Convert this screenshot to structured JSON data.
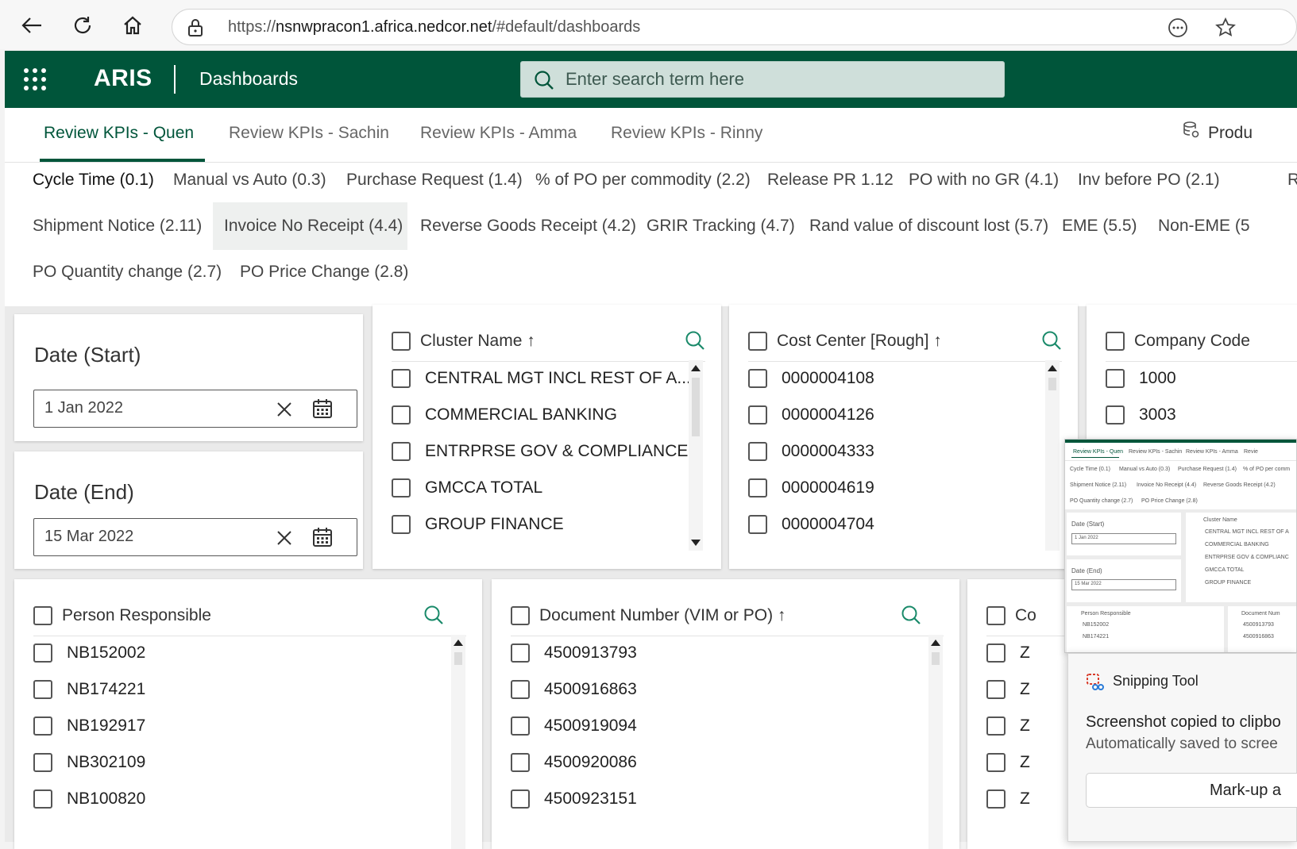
{
  "browser": {
    "url_prefix": "https://",
    "url_host": "nsnwpracon1.africa.nedcor.net",
    "url_path": "/#default/dashboards"
  },
  "header": {
    "brand": "ARIS",
    "app_name": "Dashboards",
    "search_placeholder": "Enter search term here",
    "accent_color": "#00553a"
  },
  "tabs": [
    {
      "label": "Review KPIs - Quen",
      "active": true
    },
    {
      "label": "Review KPIs - Sachin",
      "active": false
    },
    {
      "label": "Review KPIs - Amma",
      "active": false
    },
    {
      "label": "Review KPIs - Rinny",
      "active": false
    },
    {
      "label": "Produ",
      "active": false
    }
  ],
  "subtabs": [
    "Cycle Time (0.1)",
    "Manual vs Auto (0.3)",
    "Purchase Request (1.4)",
    "% of PO per commodity (2.2)",
    "Release PR 1.12",
    "PO with no GR (4.1)",
    "Inv before PO (2.1)",
    "R",
    "Shipment Notice (2.11)",
    "Invoice No Receipt (4.4)",
    "Reverse Goods Receipt (4.2)",
    "GRIR Tracking (4.7)",
    "Rand value of discount lost (5.7)",
    "EME (5.5)",
    "Non-EME (5",
    "PO Quantity change (2.7)",
    "PO Price Change (2.8)"
  ],
  "date_start": {
    "title": "Date (Start)",
    "value": "1 Jan 2022"
  },
  "date_end": {
    "title": "Date (End)",
    "value": "15 Mar 2022"
  },
  "cluster": {
    "title": "Cluster Name",
    "items": [
      "CENTRAL MGT INCL REST OF A...",
      "COMMERCIAL BANKING",
      "ENTRPRSE GOV & COMPLIANCE",
      "GMCCA TOTAL",
      "GROUP FINANCE"
    ]
  },
  "cost_center": {
    "title": "Cost Center [Rough]",
    "items": [
      "0000004108",
      "0000004126",
      "0000004333",
      "0000004619",
      "0000004704"
    ]
  },
  "company_code": {
    "title": "Company Code",
    "items": [
      "1000",
      "3003"
    ]
  },
  "person": {
    "title": "Person Responsible",
    "items": [
      "NB152002",
      "NB174221",
      "NB192917",
      "NB302109",
      "NB100820"
    ]
  },
  "document": {
    "title": "Document Number (VIM or PO)",
    "items": [
      "4500913793",
      "4500916863",
      "4500919094",
      "4500920086",
      "4500923151"
    ]
  },
  "partial_card": {
    "title": "Co",
    "items": [
      "Z",
      "Z",
      "Z",
      "Z",
      "Z"
    ]
  },
  "thumbnail": {
    "tabs": [
      "Review KPIs - Quen",
      "Review KPIs - Sachin",
      "Review KPIs - Amma",
      "Revie"
    ],
    "row1": [
      "Cycle Time (0.1)",
      "Manual vs Auto (0.3)",
      "Purchase Request (1.4)",
      "% of PO per comm"
    ],
    "row2": [
      "Shipment Notice (2.11)",
      "Invoice No Receipt (4.4)",
      "Reverse Goods Receipt (4.2)"
    ],
    "row3": [
      "PO Quantity change (2.7)",
      "PO Price Change (2.8)"
    ],
    "date_start": "Date (Start)",
    "date_start_val": "1 Jan 2022",
    "date_end": "Date (End)",
    "date_end_val": "15 Mar 2022",
    "cluster": "Cluster Name",
    "cluster_items": [
      "CENTRAL MGT INCL REST OF A",
      "COMMERCIAL BANKING",
      "ENTRPRSE GOV & COMPLIANC",
      "GMCCA TOTAL",
      "GROUP FINANCE"
    ],
    "person": "Person Responsible",
    "person_items": [
      "NB152002",
      "NB174221"
    ],
    "document": "Document Num",
    "document_items": [
      "4500913793",
      "4500916863"
    ]
  },
  "toast": {
    "app": "Snipping Tool",
    "message": "Screenshot copied to clipbo",
    "sub": "Automatically saved to scree",
    "button": "Mark-up a"
  }
}
